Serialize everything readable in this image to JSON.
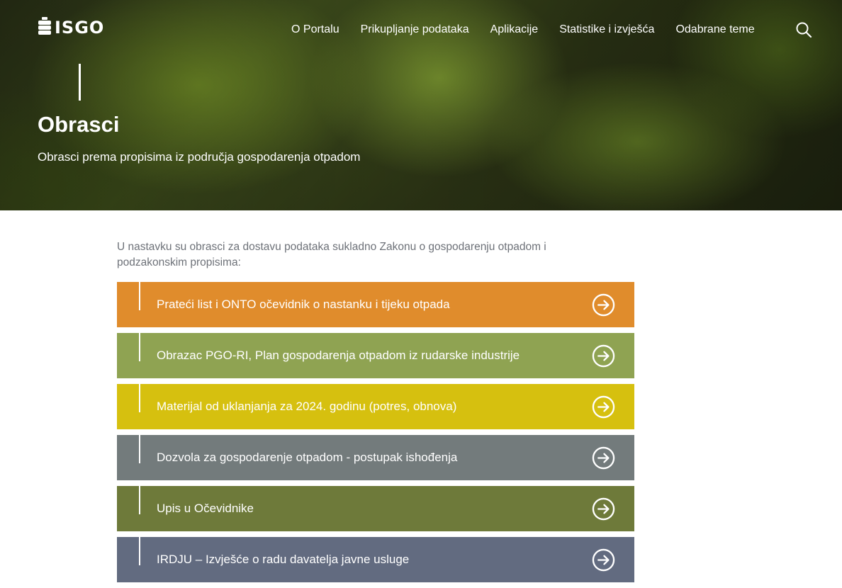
{
  "header": {
    "logo_text": "ISGO",
    "nav": [
      "O Portalu",
      "Prikupljanje podataka",
      "Aplikacije",
      "Statistike i izvješća",
      "Odabrane teme"
    ],
    "search_icon": "search-icon"
  },
  "hero": {
    "title": "Obrasci",
    "subtitle": "Obrasci prema propisima iz područja gospodarenja otpadom"
  },
  "intro": "U nastavku su obrasci za dostavu podataka sukladno Zakonu o gospodarenju otpadom i podzakonskim propisima:",
  "items": [
    {
      "label": "Prateći list i ONTO očevidnik o nastanku i tijeku otpada",
      "color": "#e08c2c"
    },
    {
      "label": "Obrazac PGO-RI, Plan gospodarenja otpadom iz rudarske industrije",
      "color": "#8fa352"
    },
    {
      "label": "Materijal od uklanjanja za 2024. godinu (potres, obnova)",
      "color": "#d6c00f"
    },
    {
      "label": "Dozvola za gospodarenje otpadom - postupak ishođenja",
      "color": "#737b7c"
    },
    {
      "label": "Upis u Očevidnike",
      "color": "#6e7a3a"
    },
    {
      "label": "IRDJU – Izvješće o radu davatelja javne usluge",
      "color": "#626b80"
    }
  ],
  "icons": {
    "item_arrow": "arrow-right-circle-icon",
    "logo": "barrel-logo-icon"
  }
}
